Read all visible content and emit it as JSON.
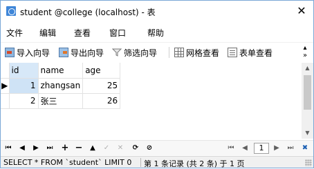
{
  "window": {
    "title": "student @college (localhost) - 表",
    "close_glyph": "✕"
  },
  "menu": [
    "文件",
    "编辑",
    "查看",
    "窗口",
    "帮助"
  ],
  "toolbar": {
    "import_label": "导入向导",
    "export_label": "导出向导",
    "filter_label": "筛选向导",
    "grid_view_label": "网格查看",
    "form_view_label": "表单查看",
    "more_glyph": "»"
  },
  "grid": {
    "columns": [
      "id",
      "name",
      "age"
    ],
    "rows": [
      {
        "id": "1",
        "name": "zhangsan",
        "age": "25"
      },
      {
        "id": "2",
        "name": "张三",
        "age": "26"
      }
    ],
    "current_row_marker": "▶"
  },
  "navigator": {
    "first": "⏮",
    "prev": "◀",
    "next": "▶",
    "last": "⏭",
    "add": "+",
    "delete": "−",
    "up": "▲",
    "check": "✓",
    "cancel": "✕",
    "refresh": "⟳",
    "stop": "⊘",
    "page_first": "⏮",
    "page_prev": "◀",
    "page_value": "1",
    "page_next": "▶",
    "page_last": "⏭",
    "settings": "✖"
  },
  "status": {
    "sql": "SELECT * FROM `student` LIMIT 0",
    "record_info": "第 1 条记录 (共 2 条) 于 1 页"
  },
  "colors": {
    "accent": "#3f86d8",
    "selected_cell": "#cfe3f6"
  }
}
